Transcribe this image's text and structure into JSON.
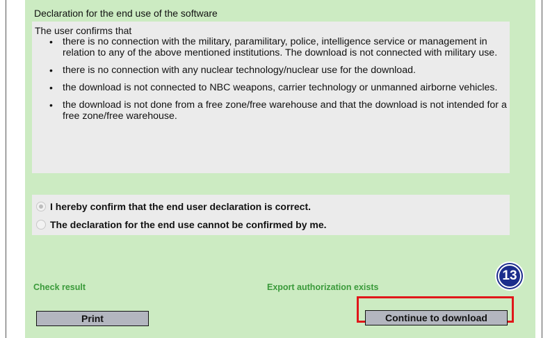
{
  "declaration": {
    "heading": "Declaration for the end use of the software",
    "intro": "The user confirms that",
    "bullets": [
      "there is no connection with the military, paramilitary, police, intelligence service or management in relation to any of the above mentioned institutions. The download is not connected with military use.",
      "there is no connection with any nuclear technology/nuclear use for the download.",
      "the download is not connected to NBC weapons, carrier technology or unmanned airborne vehicles.",
      "the download is not done from a free zone/free warehouse and that the download is not intended for a free zone/free warehouse."
    ]
  },
  "confirmation": {
    "options": [
      {
        "label": "I hereby confirm that the end user declaration is correct.",
        "selected": true
      },
      {
        "label": "The declaration for the end use cannot be confirmed by me.",
        "selected": false
      }
    ]
  },
  "status": {
    "check_result": "Check result",
    "export_authorization": "Export authorization exists"
  },
  "buttons": {
    "print": "Print",
    "continue": "Continue to download"
  },
  "annotation": {
    "step_number": "13",
    "highlight_color": "#e0171a",
    "badge_color": "#1b2d8c"
  },
  "colors": {
    "panel_background": "#ccebc2",
    "box_background": "#ebebeb",
    "status_text": "#3a9a3a",
    "button_background": "#b3b6bf"
  }
}
